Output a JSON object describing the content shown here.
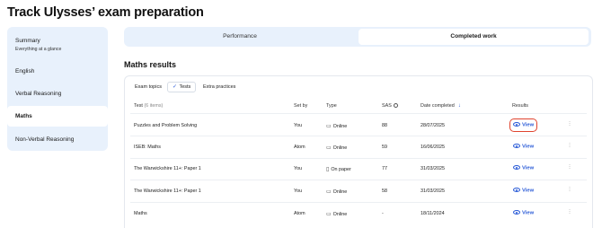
{
  "page": {
    "title": "Track Ulysses’ exam preparation"
  },
  "sidebar": {
    "items": [
      {
        "label": "Summary",
        "sublabel": "Everything at a glance"
      },
      {
        "label": "English"
      },
      {
        "label": "Verbal Reasoning"
      },
      {
        "label": "Maths",
        "active": true
      },
      {
        "label": "Non-Verbal Reasoning"
      }
    ]
  },
  "tabs": [
    {
      "label": "Performance"
    },
    {
      "label": "Completed work",
      "active": true
    }
  ],
  "section": {
    "title": "Maths results"
  },
  "filters": [
    {
      "label": "Exam topics"
    },
    {
      "label": "Tests",
      "active": true,
      "check": "✓"
    },
    {
      "label": "Extra practices"
    }
  ],
  "table": {
    "headers": {
      "test": "Test",
      "test_count": "(6 items)",
      "set_by": "Set by",
      "type": "Type",
      "sas": "SAS",
      "date": "Date completed",
      "results": "Results"
    },
    "rows": [
      {
        "test": "Puzzles and Problem Solving",
        "set_by": "You",
        "type": "Online",
        "type_icon": "laptop-icon",
        "sas": "88",
        "date": "28/07/2025",
        "action": "View"
      },
      {
        "test": "ISEB: Maths",
        "set_by": "Atom",
        "type": "Online",
        "type_icon": "laptop-icon",
        "sas": "59",
        "date": "16/06/2025",
        "action": "View"
      },
      {
        "test": "The Warwickshire 11+: Paper 1",
        "set_by": "You",
        "type": "On paper",
        "type_icon": "document-icon",
        "sas": "77",
        "date": "31/03/2025",
        "action": "View"
      },
      {
        "test": "The Warwickshire 11+: Paper 1",
        "set_by": "You",
        "type": "Online",
        "type_icon": "laptop-icon",
        "sas": "58",
        "date": "31/03/2025",
        "action": "View"
      },
      {
        "test": "Maths",
        "set_by": "Atom",
        "type": "Online",
        "type_icon": "laptop-icon",
        "sas": "-",
        "date": "18/11/2024",
        "action": "View"
      }
    ]
  },
  "colors": {
    "accent": "#2a5bd7",
    "sidebar_bg": "#e8f1fc",
    "highlight": "#e0442f"
  }
}
